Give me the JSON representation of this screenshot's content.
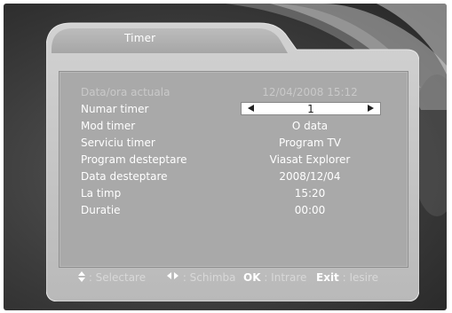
{
  "dialog": {
    "title": "Timer"
  },
  "fields": [
    {
      "label": "Data/ora actuala",
      "value": "12/04/2008 15:12"
    },
    {
      "label": "Numar timer",
      "value": "1"
    },
    {
      "label": "Mod timer",
      "value": "O data"
    },
    {
      "label": "Serviciu timer",
      "value": "Program TV"
    },
    {
      "label": "Program desteptare",
      "value": "Viasat Explorer"
    },
    {
      "label": "Data desteptare",
      "value": "2008/12/04"
    },
    {
      "label": "La timp",
      "value": "15:20"
    },
    {
      "label": "Duratie",
      "value": "00:00"
    }
  ],
  "footer": {
    "select_label": ": Selectare",
    "change_label": ": Schimba",
    "ok_key": "OK",
    "ok_label": ": Intrare",
    "exit_key": "Exit",
    "exit_label": ": Iesire"
  },
  "icons": {
    "updown": "up-down-arrows-icon",
    "leftright": "left-right-arrows-icon",
    "selector_left": "arrow-left-icon",
    "selector_right": "arrow-right-icon"
  },
  "colors": {
    "background": "#3c3c3c",
    "dialog_frame": "#c8c8c8",
    "panel": "#a9a9a9",
    "text": "#ffffff",
    "dim_text": "#c9c9c9",
    "selector": "#ffffff"
  }
}
